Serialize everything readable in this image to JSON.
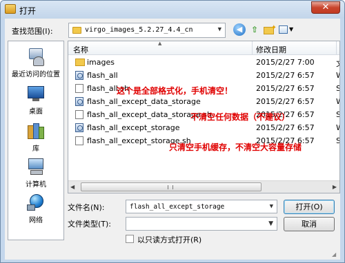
{
  "window": {
    "title": "打开",
    "close_glyph": "✕"
  },
  "lookin": {
    "label": "查找范围(I):",
    "value": "virgo_images_5.2.27_4.4_cn"
  },
  "toolbar_icons": [
    "back-icon",
    "up-folder-icon",
    "new-folder-icon",
    "view-menu-icon"
  ],
  "places": [
    {
      "label": "最近访问的位置",
      "icon": "recent-places-icon"
    },
    {
      "label": "桌面",
      "icon": "desktop-icon"
    },
    {
      "label": "库",
      "icon": "libraries-icon"
    },
    {
      "label": "计算机",
      "icon": "computer-icon"
    },
    {
      "label": "网络",
      "icon": "network-icon"
    }
  ],
  "columns": {
    "name": "名称",
    "date": "修改日期"
  },
  "files": [
    {
      "name": "images",
      "date": "2015/2/27 7:00",
      "type": "文",
      "icon": "folder"
    },
    {
      "name": "flash_all",
      "date": "2015/2/27 6:57",
      "type": "W",
      "icon": "bat"
    },
    {
      "name": "flash_all.sh",
      "date": "2015/2/27 6:57",
      "type": "S",
      "icon": "doc"
    },
    {
      "name": "flash_all_except_data_storage",
      "date": "2015/2/27 6:57",
      "type": "W",
      "icon": "bat"
    },
    {
      "name": "flash_all_except_data_storage.sh",
      "date": "2015/2/27 6:57",
      "type": "S",
      "icon": "doc"
    },
    {
      "name": "flash_all_except_storage",
      "date": "2015/2/27 6:57",
      "type": "W",
      "icon": "bat"
    },
    {
      "name": "flash_all_except_storage.sh",
      "date": "2015/2/27 6:57",
      "type": "S",
      "icon": "doc"
    }
  ],
  "annotations": [
    "这个是全部格式化，手机清空！",
    "不清空任何数据（不建议）",
    "只清空手机缓存，不清空大容量存储"
  ],
  "filename": {
    "label": "文件名(N):",
    "value": "flash_all_except_storage"
  },
  "filetype": {
    "label": "文件类型(T):",
    "value": ""
  },
  "readonly": {
    "label": "以只读方式打开(R)",
    "checked": false
  },
  "buttons": {
    "open": "打开(O)",
    "cancel": "取消"
  }
}
